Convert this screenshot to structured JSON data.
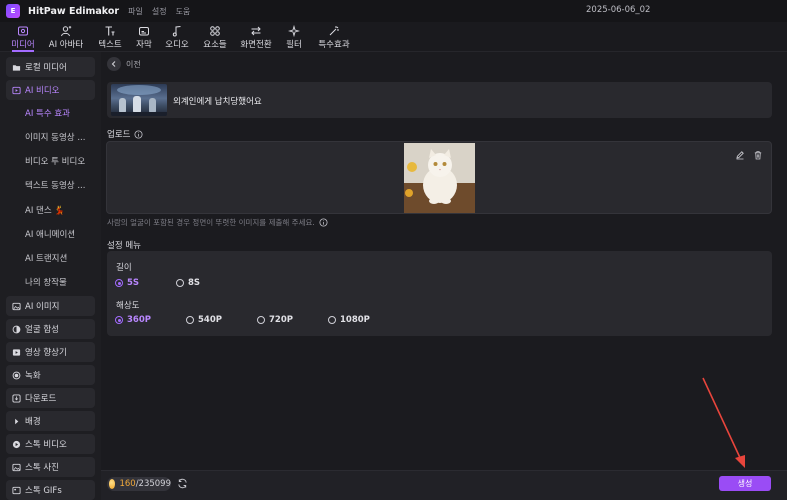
{
  "titlebar": {
    "app_title": "HitPaw Edimakor",
    "menu": [
      "파일",
      "설정",
      "도움"
    ],
    "project_name": "2025-06-06_02"
  },
  "toolbar": {
    "items": [
      {
        "label": "미디어",
        "icon": "media-icon",
        "active": true
      },
      {
        "label": "AI 아바타",
        "icon": "avatar-icon"
      },
      {
        "label": "텍스트",
        "icon": "text-icon"
      },
      {
        "label": "자막",
        "icon": "subtitle-icon"
      },
      {
        "label": "오디오",
        "icon": "audio-icon"
      },
      {
        "label": "요소들",
        "icon": "elements-icon"
      },
      {
        "label": "화면전환",
        "icon": "transition-icon"
      },
      {
        "label": "필터",
        "icon": "filter-icon"
      },
      {
        "label": "특수효과",
        "icon": "effects-icon"
      }
    ]
  },
  "sidebar": {
    "local_media": "로컬 미디어",
    "ai_video": "AI 비디오",
    "sub_items": [
      "AI 특수 효과",
      "이미지 동영상 ...",
      "비디오 투 비디오",
      "텍스트 동영상 ...",
      "AI 댄스 💃",
      "AI 애니메이션",
      "AI 트랜지션",
      "나의 창작물"
    ],
    "items": [
      "AI 이미지",
      "얼굴 합성",
      "영상 향상기",
      "녹화",
      "다운로드",
      "배경",
      "스톡 비디오",
      "스톡 사진",
      "스톡 GIFs"
    ]
  },
  "main": {
    "back_label": "이전",
    "effect_name": "외계인에게 납치당했어요",
    "upload_label": "업로드",
    "hint": "사람의 얼굴이 포함된 경우 정면이 뚜렷한 이미지를 제출해 주세요.",
    "settings_label": "설정 메뉴",
    "length_label": "길이",
    "length_options": [
      "5S",
      "8S"
    ],
    "resolution_label": "해상도",
    "resolution_options": [
      "360P",
      "540P",
      "720P",
      "1080P"
    ]
  },
  "bottombar": {
    "credits_used": "160",
    "credits_total": "/235099",
    "generate_label": "생성"
  },
  "colors": {
    "accent": "#a36bff",
    "generate_button": "#9a4cf5",
    "annotation_arrow": "#e8453c"
  }
}
